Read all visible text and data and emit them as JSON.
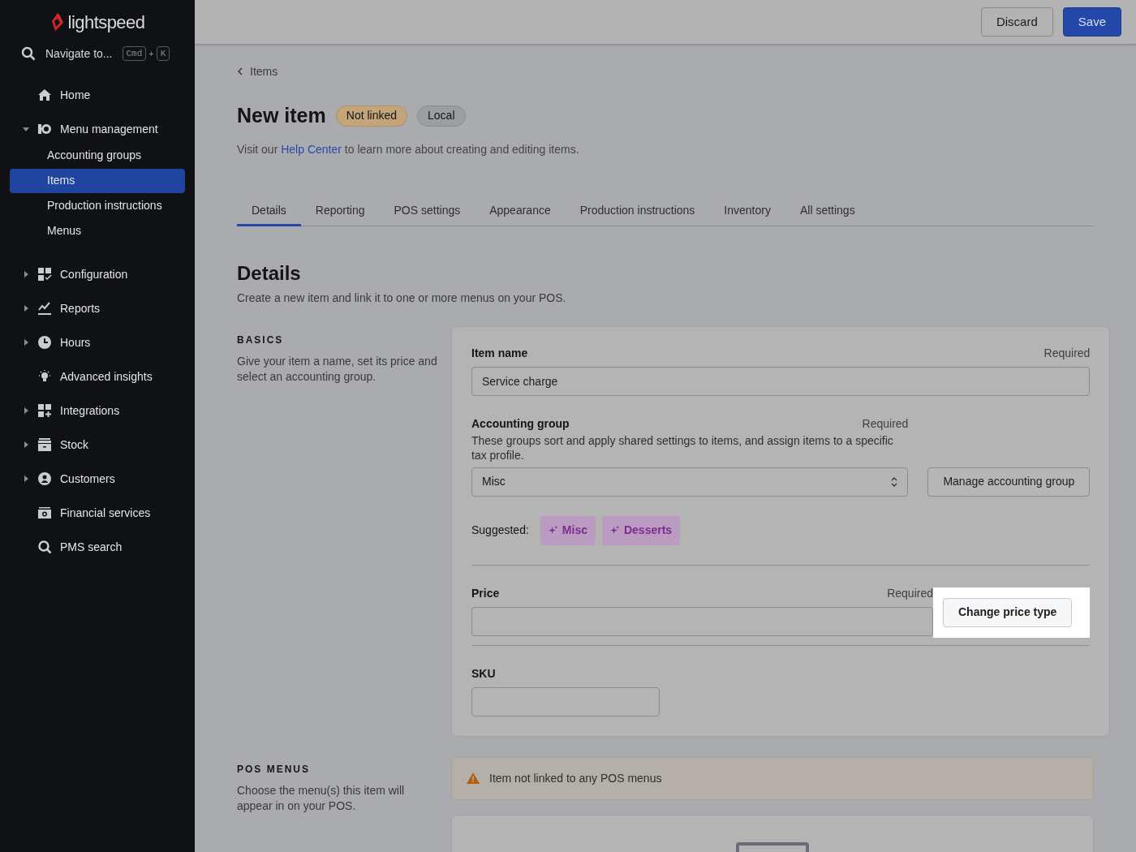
{
  "sidebar": {
    "logo": "lightspeed",
    "search": {
      "label": "Navigate to...",
      "keys": [
        "Cmd",
        "+",
        "K"
      ]
    },
    "items": [
      {
        "label": "Home"
      },
      {
        "label": "Menu management",
        "expanded": true,
        "children": [
          {
            "label": "Accounting groups",
            "selected": false
          },
          {
            "label": "Items",
            "selected": true
          },
          {
            "label": "Production instructions",
            "selected": false
          },
          {
            "label": "Menus",
            "selected": false
          }
        ]
      },
      {
        "label": "Configuration",
        "expanded": false
      },
      {
        "label": "Reports",
        "expanded": false
      },
      {
        "label": "Hours",
        "expanded": false
      },
      {
        "label": "Advanced insights"
      },
      {
        "label": "Integrations",
        "expanded": false
      },
      {
        "label": "Stock",
        "expanded": false
      },
      {
        "label": "Customers",
        "expanded": false
      },
      {
        "label": "Financial services"
      },
      {
        "label": "PMS search"
      }
    ]
  },
  "top_bar": {
    "buttons": [
      {
        "label": "Discard",
        "kind": "secondary"
      },
      {
        "label": "Save",
        "kind": "primary"
      }
    ]
  },
  "breadcrumb": "Items",
  "title": "New item",
  "badges": [
    {
      "label": "Not linked",
      "kind": "warning"
    },
    {
      "label": "Local",
      "kind": "neutral"
    }
  ],
  "help": {
    "before": "Visit our ",
    "link": "Help Center",
    "after": " to learn more about creating and editing items."
  },
  "tabs": [
    {
      "label": "Details",
      "selected": true
    },
    {
      "label": "Reporting",
      "selected": false
    },
    {
      "label": "POS settings",
      "selected": false
    },
    {
      "label": "Appearance",
      "selected": false
    },
    {
      "label": "Production instructions",
      "selected": false
    },
    {
      "label": "Inventory",
      "selected": false
    },
    {
      "label": "All settings",
      "selected": false
    }
  ],
  "details": {
    "heading": "Details",
    "description": "Create a new item and link it to one or more menus on your POS."
  },
  "basics": {
    "heading": "BASICS",
    "description": "Give your item a name, set its price and select an accounting group.",
    "item_name": {
      "label": "Item name",
      "required": "Required",
      "value": "Service charge"
    },
    "accounting_group": {
      "label": "Accounting group",
      "required": "Required",
      "hint": "These groups sort and apply shared settings to items, and assign items to a specific tax profile.",
      "value": "Misc",
      "manage_button": "Manage accounting group"
    },
    "suggested": {
      "label": "Suggested:",
      "chips": [
        "Misc",
        "Desserts"
      ]
    },
    "price": {
      "label": "Price",
      "required": "Required",
      "button": "Change price type",
      "highlighted": true
    },
    "sku": {
      "label": "SKU"
    }
  },
  "pos_menus": {
    "heading": "POS MENUS",
    "description": "Choose the menu(s) this item will appear in on your POS.",
    "warning": "Item not linked to any POS menus"
  }
}
